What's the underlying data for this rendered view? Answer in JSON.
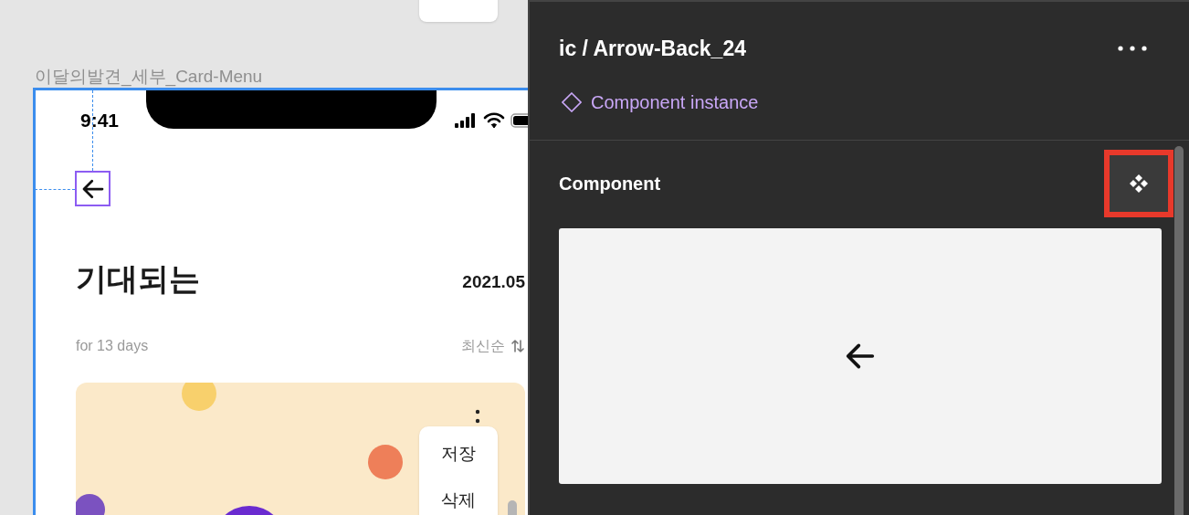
{
  "canvas": {
    "frame_label": "이달의발견_세부_Card-Menu",
    "status_bar": {
      "time": "9:41"
    },
    "back_button": {
      "selected": true
    },
    "header": {
      "title": "기대되는",
      "date": "2021.05"
    },
    "subheader": {
      "duration": "for 13 days",
      "sort": "최신순"
    },
    "card_menu": {
      "items": [
        "저장",
        "삭제"
      ]
    }
  },
  "inspector": {
    "title": "ic / Arrow-Back_24",
    "subtitle": "Component instance",
    "section": {
      "title": "Component",
      "highlighted": true
    }
  }
}
